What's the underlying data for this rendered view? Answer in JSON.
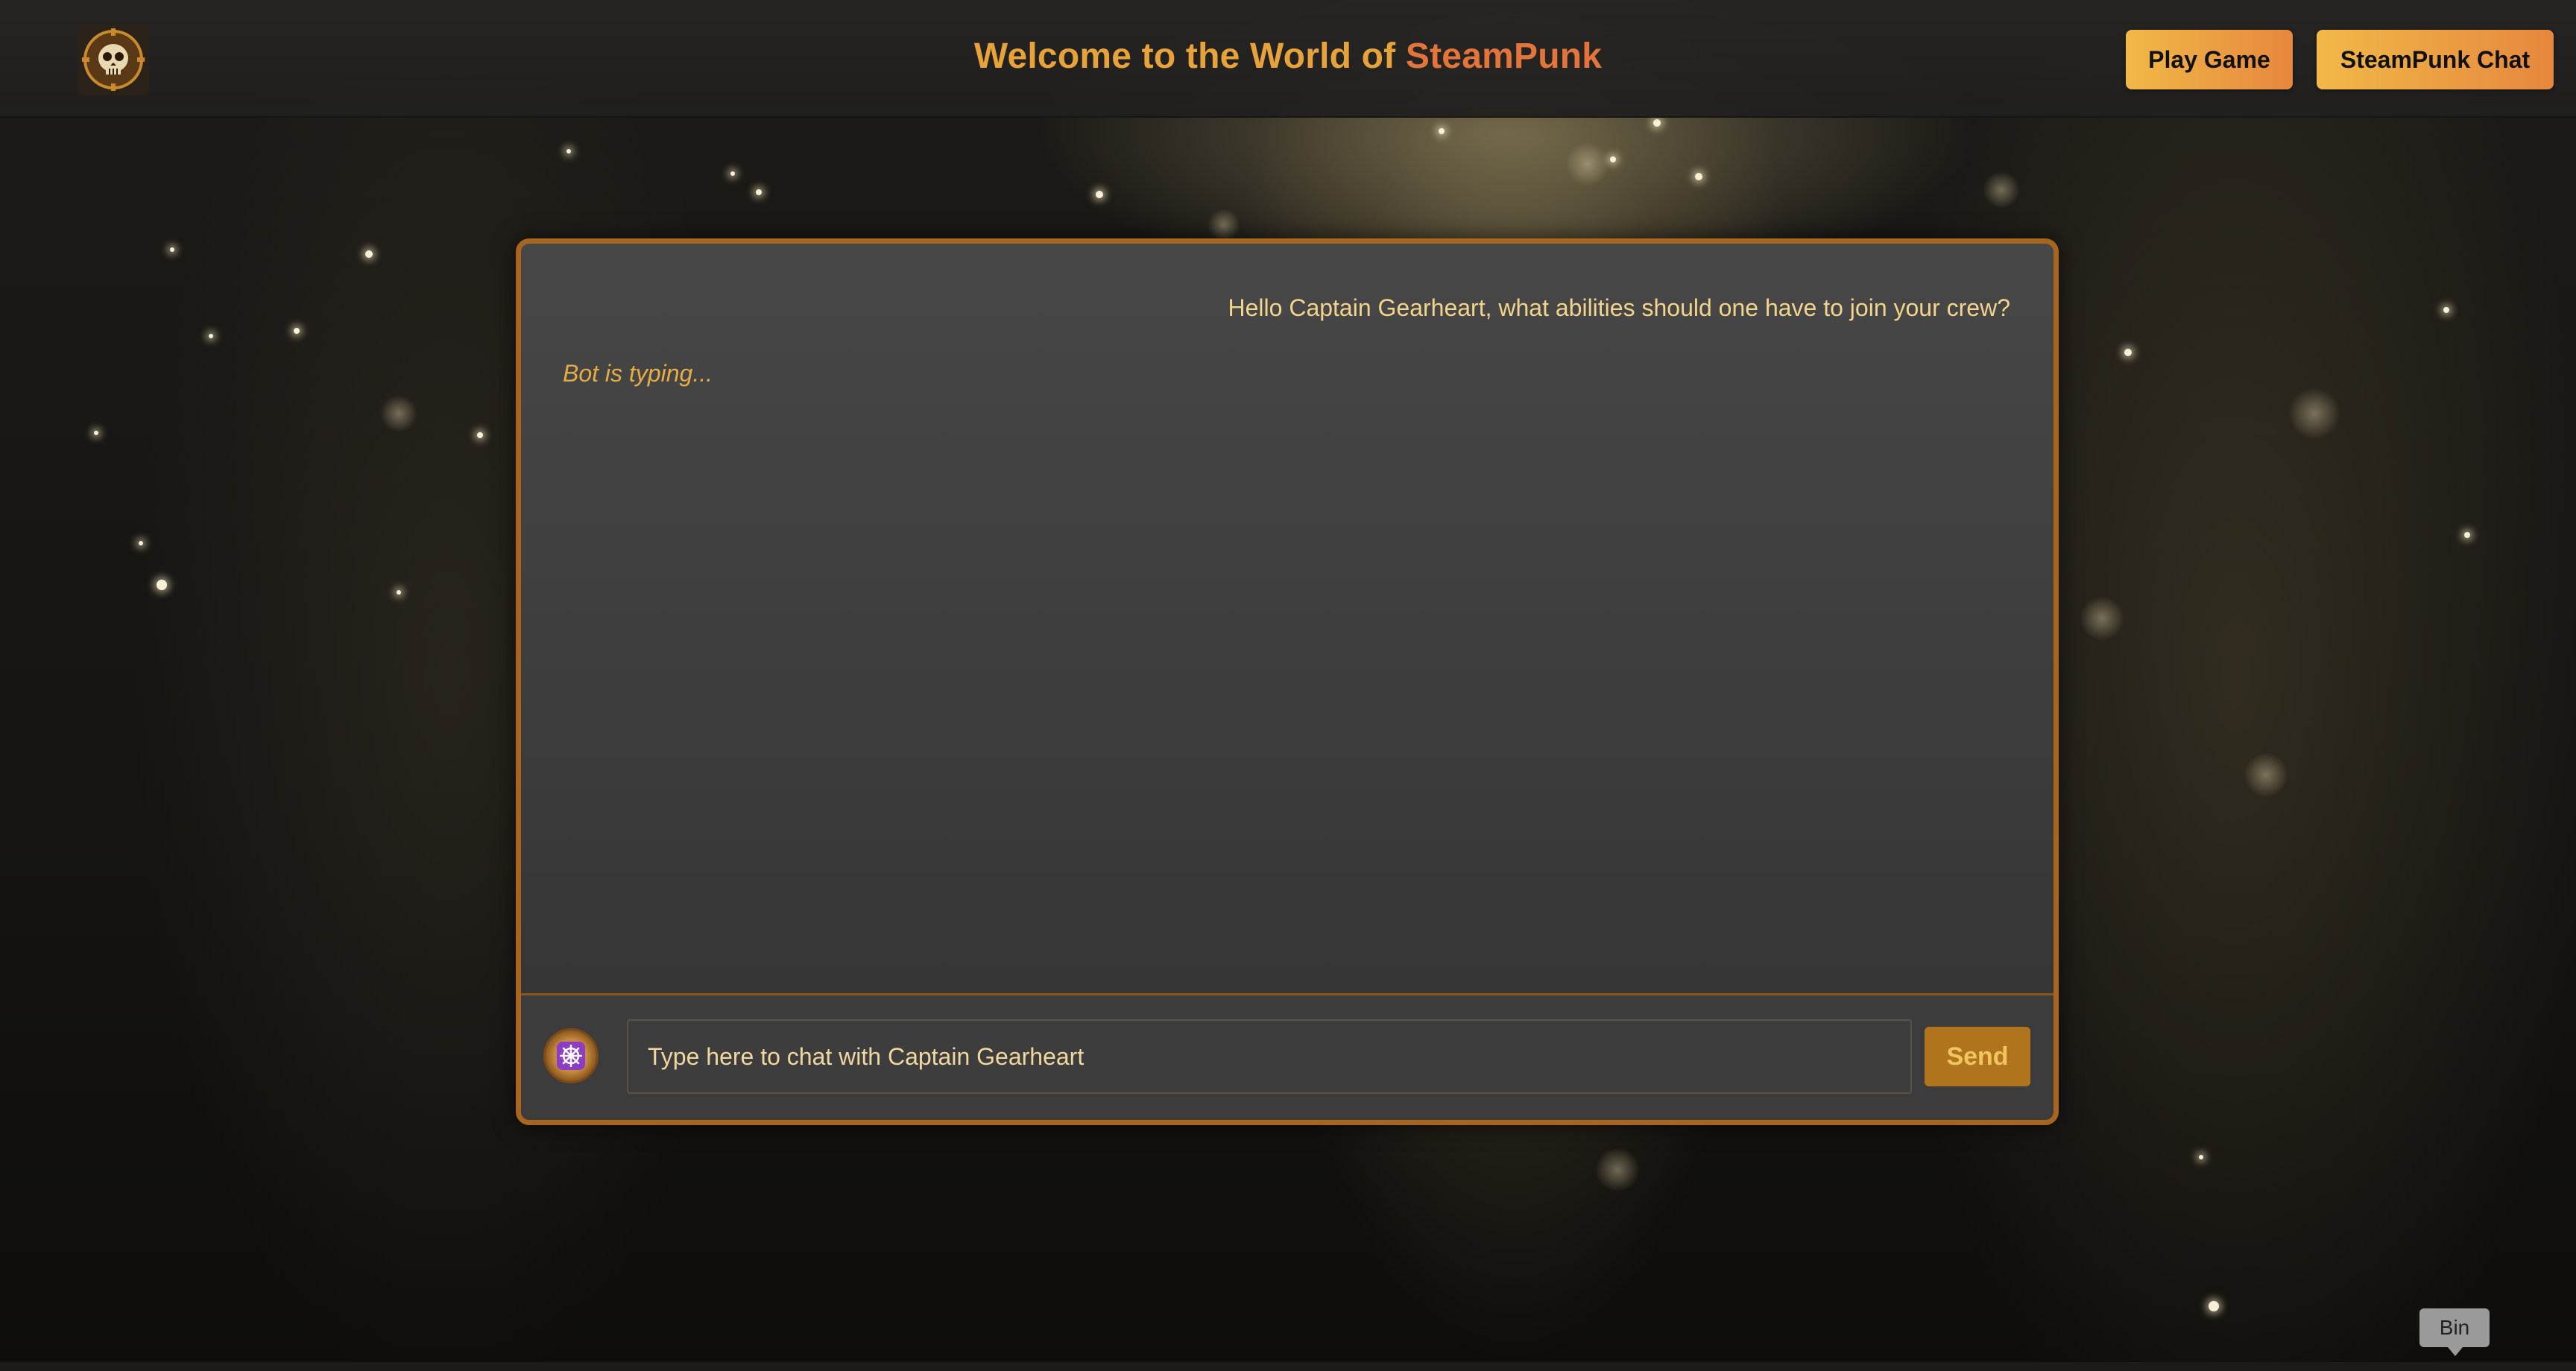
{
  "header": {
    "title_part1": "Welcome to the World of ",
    "title_part2": "SteamPunk",
    "logo_icon": "steampunk-skull-logo-icon",
    "buttons": {
      "play_game": "Play Game",
      "steampunk_chat": "SteamPunk Chat"
    }
  },
  "chat": {
    "messages": {
      "user": "Hello Captain Gearheart, what abilities should one have to join your crew?",
      "typing": "Bot is typing..."
    },
    "input": {
      "placeholder": "Type here to chat with Captain Gearheart",
      "value": ""
    },
    "avatar_icon": "ship-wheel-icon",
    "send_label": "Send"
  },
  "tooltip": {
    "label": "Bin"
  },
  "colors": {
    "accent_gold": "#e8a23a",
    "accent_orange": "#e2743c",
    "panel_border": "#a8651f",
    "send_button": "#b0741f",
    "text_light": "#f3d48c"
  }
}
